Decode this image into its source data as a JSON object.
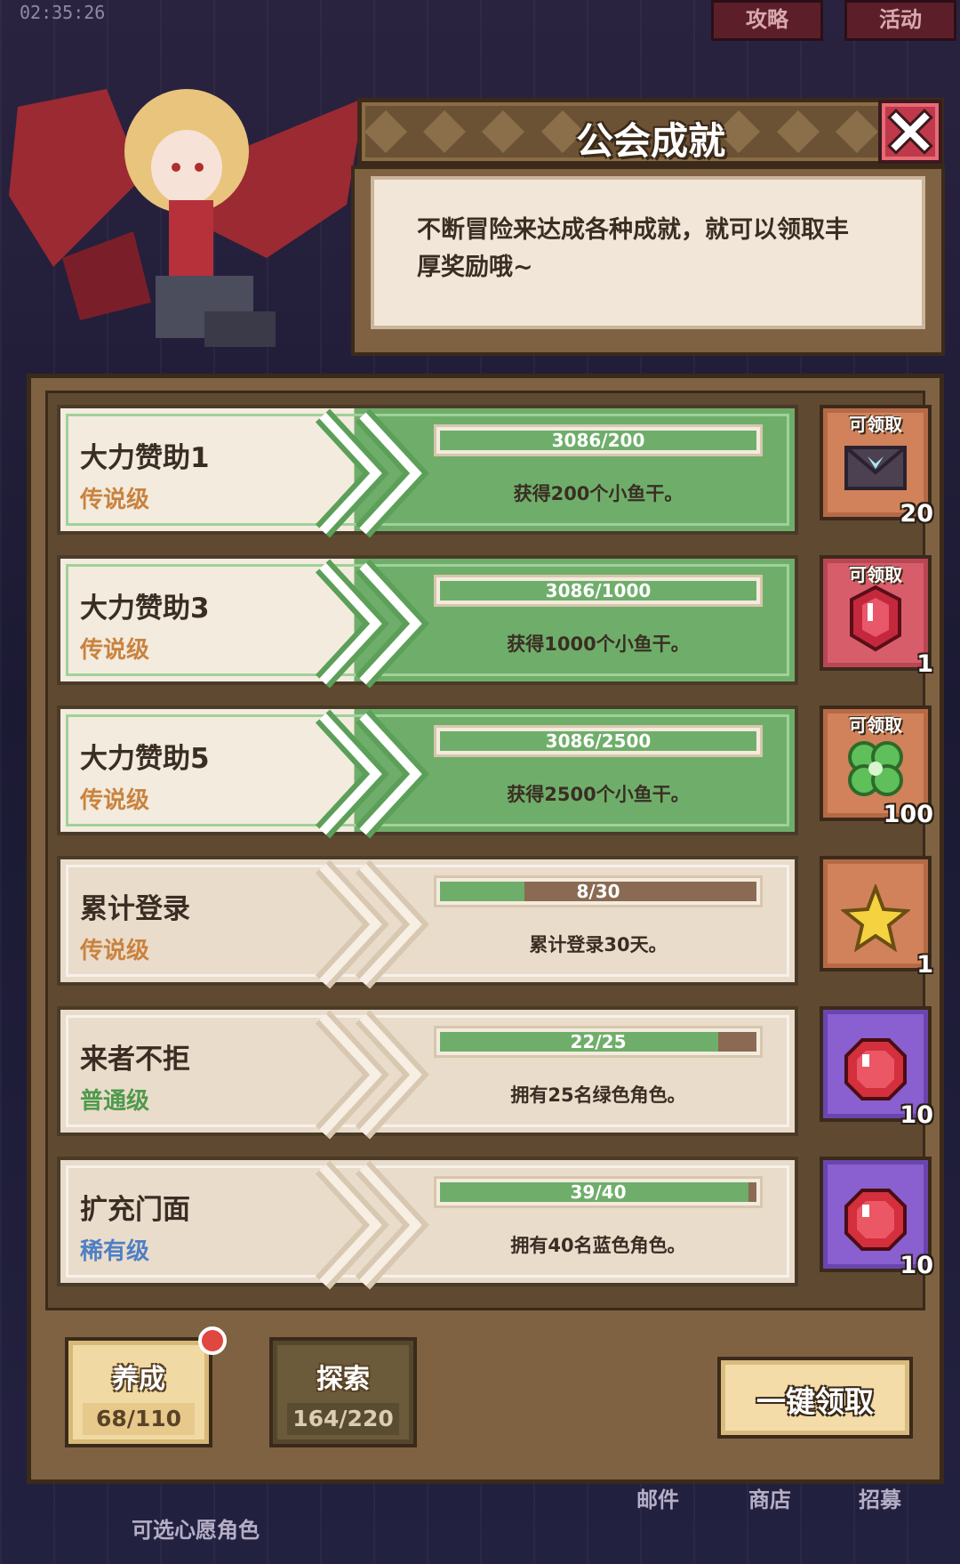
{
  "status": {
    "clock": "02:35:26"
  },
  "top_tabs": [
    {
      "label": "攻略"
    },
    {
      "label": "活动"
    }
  ],
  "dialog": {
    "title": "公会成就",
    "description": "不断冒险来达成各种成就，就可以领取丰厚奖励哦~"
  },
  "colors": {
    "legendary": "#c9833f",
    "common": "#4f9a4c",
    "rare": "#4f7fc4",
    "bar_fill": "#6fae6a"
  },
  "achievements": [
    {
      "name": "大力赞助1",
      "tier": "传说级",
      "tier_color": "#c9833f",
      "progress_text": "3086/200",
      "progress": 1.0,
      "desc": "获得200个小鱼干。",
      "completed": true,
      "claim_label": "可领取",
      "reward_icon": "envelope-icon",
      "reward_count": "20",
      "reward_bg": "orange"
    },
    {
      "name": "大力赞助3",
      "tier": "传说级",
      "tier_color": "#c9833f",
      "progress_text": "3086/1000",
      "progress": 1.0,
      "desc": "获得1000个小鱼干。",
      "completed": true,
      "claim_label": "可领取",
      "reward_icon": "ruby-gem-icon",
      "reward_count": "1",
      "reward_bg": "red"
    },
    {
      "name": "大力赞助5",
      "tier": "传说级",
      "tier_color": "#c9833f",
      "progress_text": "3086/2500",
      "progress": 1.0,
      "desc": "获得2500个小鱼干。",
      "completed": true,
      "claim_label": "可领取",
      "reward_icon": "clover-icon",
      "reward_count": "100",
      "reward_bg": "orange"
    },
    {
      "name": "累计登录",
      "tier": "传说级",
      "tier_color": "#c9833f",
      "progress_text": "8/30",
      "progress": 0.267,
      "desc": "累计登录30天。",
      "completed": false,
      "claim_label": "",
      "reward_icon": "star-icon",
      "reward_count": "1",
      "reward_bg": "orange"
    },
    {
      "name": "来者不拒",
      "tier": "普通级",
      "tier_color": "#4f9a4c",
      "progress_text": "22/25",
      "progress": 0.88,
      "desc": "拥有25名绿色角色。",
      "completed": false,
      "claim_label": "",
      "reward_icon": "red-gem-icon",
      "reward_count": "10",
      "reward_bg": "purple"
    },
    {
      "name": "扩充门面",
      "tier": "稀有级",
      "tier_color": "#4f7fc4",
      "progress_text": "39/40",
      "progress": 0.975,
      "desc": "拥有40名蓝色角色。",
      "completed": false,
      "claim_label": "",
      "reward_icon": "red-gem-icon",
      "reward_count": "10",
      "reward_bg": "purple"
    }
  ],
  "categories": [
    {
      "label": "养成",
      "value": "68/110",
      "active": true
    },
    {
      "label": "探索",
      "value": "164/220",
      "active": false
    }
  ],
  "claim_all_label": "一键领取",
  "bottom_nav": [
    {
      "label": "邮件"
    },
    {
      "label": "商店"
    },
    {
      "label": "招募"
    }
  ],
  "wish_text": "可选心愿角色"
}
